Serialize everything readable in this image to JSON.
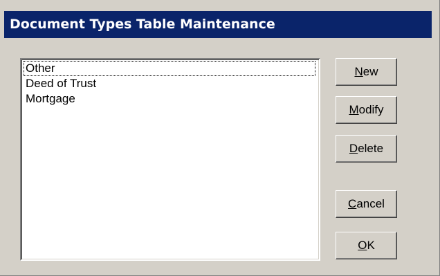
{
  "window": {
    "title": "Document Types Table Maintenance"
  },
  "list": {
    "items": [
      "Other",
      "Deed of Trust",
      "Mortgage"
    ],
    "focused_index": 0
  },
  "buttons": {
    "new": {
      "mnemonic": "N",
      "rest": "ew"
    },
    "modify": {
      "mnemonic": "M",
      "rest": "odify"
    },
    "delete": {
      "mnemonic": "D",
      "rest": "elete"
    },
    "cancel": {
      "mnemonic": "C",
      "rest": "ancel"
    },
    "ok": {
      "mnemonic": "O",
      "rest": "K"
    }
  },
  "colors": {
    "title_bar": "#0a246a",
    "face": "#d4d0c8"
  }
}
